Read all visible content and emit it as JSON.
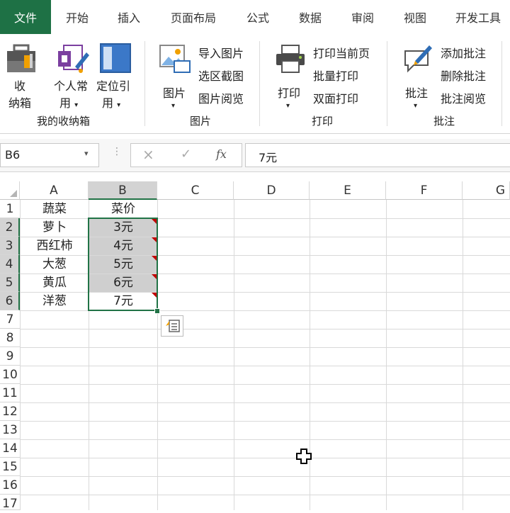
{
  "tabs": [
    {
      "label": "文件",
      "active": true
    },
    {
      "label": "开始"
    },
    {
      "label": "插入"
    },
    {
      "label": "页面布局"
    },
    {
      "label": "公式"
    },
    {
      "label": "数据"
    },
    {
      "label": "审阅"
    },
    {
      "label": "视图"
    },
    {
      "label": "开发工具"
    }
  ],
  "ribbon": {
    "storage": {
      "label": "我的收纳箱",
      "buttons": [
        {
          "line1": "收",
          "line2": "纳箱"
        },
        {
          "line1": "个人常",
          "line2": "用"
        },
        {
          "line1": "定位引",
          "line2": "用"
        }
      ]
    },
    "picture": {
      "label": "图片",
      "big": "图片",
      "items": [
        "导入图片",
        "选区截图",
        "图片阅览"
      ]
    },
    "print": {
      "label": "打印",
      "big": "打印",
      "items": [
        "打印当前页",
        "批量打印",
        "双面打印"
      ]
    },
    "comment": {
      "label": "批注",
      "big": "批注",
      "items": [
        "添加批注",
        "删除批注",
        "批注阅览"
      ]
    }
  },
  "formula_bar": {
    "name_box": "B6",
    "cancel": "×",
    "enter": "✓",
    "fx": "fx",
    "value": "7元"
  },
  "sheet": {
    "columns": [
      "A",
      "B",
      "C",
      "D",
      "E",
      "F",
      "G"
    ],
    "rows": [
      "1",
      "2",
      "3",
      "4",
      "5",
      "6",
      "7",
      "8",
      "9",
      "10",
      "11",
      "12",
      "13",
      "14",
      "15",
      "16",
      "17"
    ],
    "cells": [
      [
        "蔬菜",
        "菜价"
      ],
      [
        "萝卜",
        "3元"
      ],
      [
        "西红柿",
        "4元"
      ],
      [
        "大葱",
        "5元"
      ],
      [
        "黄瓜",
        "6元"
      ],
      [
        "洋葱",
        "7元"
      ]
    ],
    "selected_cell": "B6"
  },
  "colors": {
    "accent": "#1e7145",
    "comment_marker": "#c00000",
    "selection": "#217346"
  },
  "icons": [
    "toolbox-icon",
    "personal-common-icon",
    "locate-reference-icon",
    "picture-icon",
    "printer-icon",
    "comment-pen-icon",
    "quick-analysis-icon",
    "cross-cursor-icon"
  ]
}
